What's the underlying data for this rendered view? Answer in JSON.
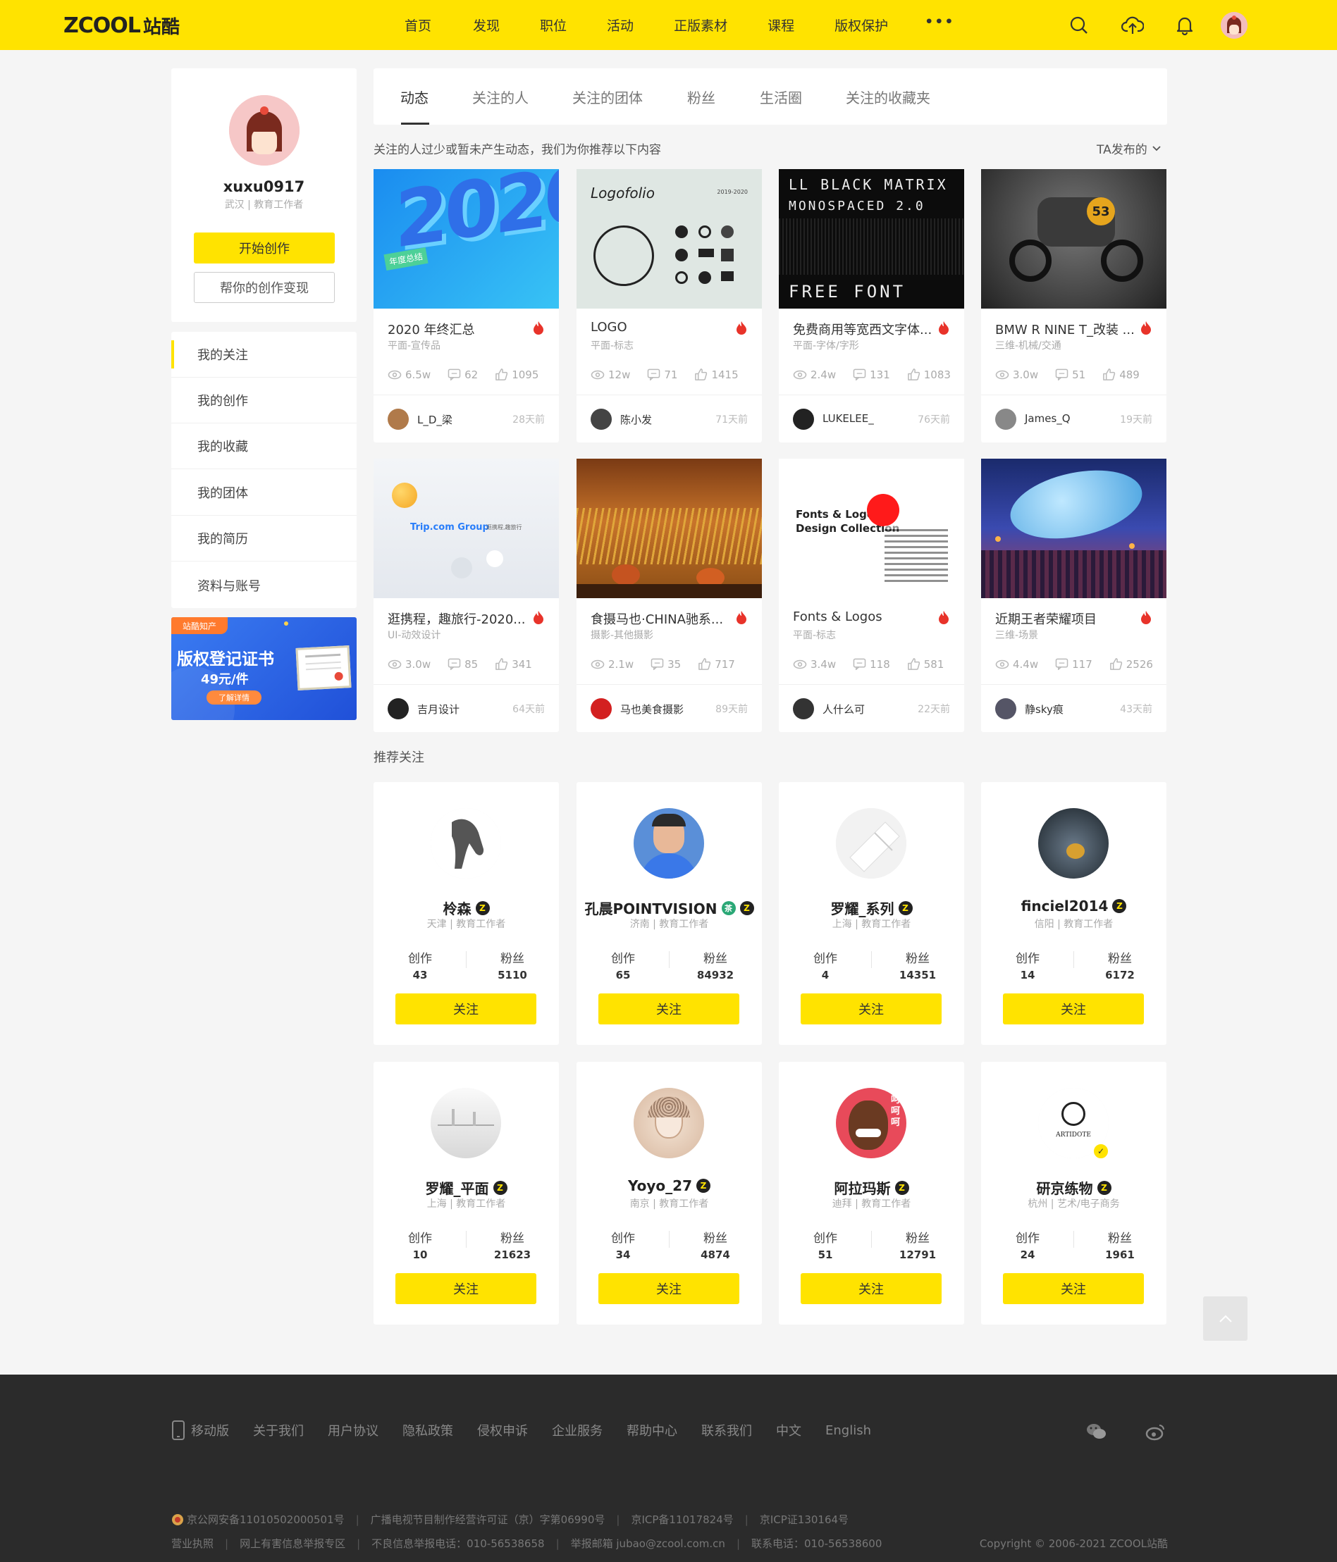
{
  "header": {
    "logo": "ZCOOL",
    "logo_cn": "站酷",
    "nav": [
      "首页",
      "发现",
      "职位",
      "活动",
      "正版素材",
      "课程",
      "版权保护"
    ],
    "more": "•••"
  },
  "profile": {
    "name": "xuxu0917",
    "location": "武汉 | 教育工作者",
    "start_btn": "开始创作",
    "monetize_btn": "帮你的创作变现"
  },
  "menu": [
    "我的关注",
    "我的创作",
    "我的收藏",
    "我的团体",
    "我的简历",
    "资料与账号"
  ],
  "banner": {
    "tag": "站酷知产",
    "title": "版权登记证书",
    "price": "49元/件",
    "cta": "了解详情"
  },
  "tabs": [
    "动态",
    "关注的人",
    "关注的团体",
    "粉丝",
    "生活圈",
    "关注的收藏夹"
  ],
  "hint": "关注的人过少或暂未产生动态，我们为你推荐以下内容",
  "filter": "TA发布的",
  "works": [
    {
      "title": "2020 年终汇总",
      "cat": "平面-宣传品",
      "views": "6.5w",
      "comments": "62",
      "likes": "1095",
      "author": "L_D_梁",
      "time": "28天前",
      "img_text": "2020",
      "img_tag": "年度总结"
    },
    {
      "title": "LOGO",
      "cat": "平面-标志",
      "views": "12w",
      "comments": "71",
      "likes": "1415",
      "author": "陈小发",
      "time": "71天前",
      "img_text": "Logofolio",
      "img_tag": "2019-2020"
    },
    {
      "title": "免费商用等宽西文字体...",
      "cat": "平面-字体/字形",
      "views": "2.4w",
      "comments": "131",
      "likes": "1083",
      "author": "LUKELEE_",
      "time": "76天前",
      "img_text": "LL BLACK MATRIX",
      "img_tag": "MONOSPACED 2.0",
      "img_sub": "FREE FONT"
    },
    {
      "title": "BMW R NINE T_改装 ...",
      "cat": "三维-机械/交通",
      "views": "3.0w",
      "comments": "51",
      "likes": "489",
      "author": "James_Q",
      "time": "19天前",
      "img_text": "53"
    },
    {
      "title": "逛携程，趣旅行-2020...",
      "cat": "UI-动效设计",
      "views": "3.0w",
      "comments": "85",
      "likes": "341",
      "author": "吉月设计",
      "time": "64天前",
      "img_text": "Trip.com Group",
      "img_tag": "逛携程,趣旅行"
    },
    {
      "title": "食摄马也·CHINA驰系...",
      "cat": "摄影-其他摄影",
      "views": "2.1w",
      "comments": "35",
      "likes": "717",
      "author": "马也美食摄影",
      "time": "89天前"
    },
    {
      "title": "Fonts & Logos",
      "cat": "平面-标志",
      "views": "3.4w",
      "comments": "118",
      "likes": "581",
      "author": "人什么可",
      "time": "22天前",
      "img_text": "Fonts & Logos",
      "img_tag": "Design Collection"
    },
    {
      "title": "近期王者荣耀项目",
      "cat": "三维-场景",
      "views": "4.4w",
      "comments": "117",
      "likes": "2526",
      "author": "静sky痕",
      "time": "43天前"
    }
  ],
  "recommend": {
    "title": "推荐关注",
    "label_works": "创作",
    "label_fans": "粉丝",
    "follow": "关注",
    "users": [
      {
        "name": "柃森",
        "loc": "天津 | 教育工作者",
        "works": "43",
        "fans": "5110"
      },
      {
        "name": "孔晨POINTVISION",
        "loc": "济南 | 教育工作者",
        "works": "65",
        "fans": "84932",
        "extra": "茶"
      },
      {
        "name": "罗耀_系列",
        "loc": "上海 | 教育工作者",
        "works": "4",
        "fans": "14351"
      },
      {
        "name": "finciel2014",
        "loc": "信阳 | 教育工作者",
        "works": "14",
        "fans": "6172"
      },
      {
        "name": "罗耀_平面",
        "loc": "上海 | 教育工作者",
        "works": "10",
        "fans": "21623"
      },
      {
        "name": "Yoyo_27",
        "loc": "南京 | 教育工作者",
        "works": "34",
        "fans": "4874"
      },
      {
        "name": "阿拉玛斯",
        "loc": "迪拜 | 教育工作者",
        "works": "51",
        "fans": "12791",
        "avatar_text": "呵呵呵"
      },
      {
        "name": "研京练物",
        "loc": "杭州 | 艺术/电子商务",
        "works": "24",
        "fans": "1961",
        "avatar_text": "ARTIDOTE"
      }
    ]
  },
  "footer": {
    "links": [
      "移动版",
      "关于我们",
      "用户协议",
      "隐私政策",
      "侵权申诉",
      "企业服务",
      "帮助中心",
      "联系我们",
      "中文",
      "English"
    ],
    "row1": [
      "京公网安备11010502000501号",
      "广播电视节目制作经营许可证（京）字第06990号",
      "京ICP备11017824号",
      "京ICP证130164号"
    ],
    "row2": [
      "营业执照",
      "网上有害信息举报专区",
      "不良信息举报电话：010-56538658",
      "举报邮箱 jubao@zcool.com.cn",
      "联系电话：010-56538600"
    ],
    "copyright": "Copyright © 2006-2021 ZCOOL站酷"
  },
  "colors": {
    "accent": "#ffe300",
    "footer_bg": "#2b2b2b",
    "fire": "#e8332a"
  }
}
